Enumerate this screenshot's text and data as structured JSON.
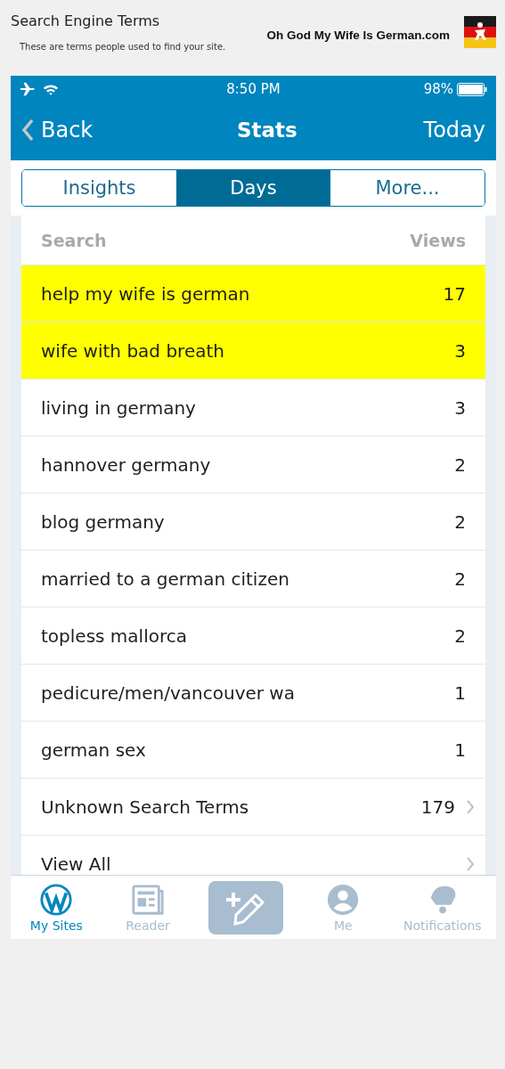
{
  "page": {
    "title": "Search Engine Terms",
    "subtitle": "These are terms people used to find your site.",
    "site_name": "Oh God My Wife Is German.com"
  },
  "status_bar": {
    "time": "8:50 PM",
    "battery": "98%"
  },
  "nav_bar": {
    "back": "Back",
    "title": "Stats",
    "right": "Today"
  },
  "tabs": [
    {
      "label": "Insights",
      "selected": false
    },
    {
      "label": "Days",
      "selected": true
    },
    {
      "label": "More...",
      "selected": false
    }
  ],
  "table": {
    "columns": [
      "Search",
      "Views"
    ],
    "rows": [
      {
        "term": "help my wife is german",
        "views": "17",
        "highlighted": true,
        "kind": "term"
      },
      {
        "term": "wife with bad breath",
        "views": "3",
        "highlighted": true,
        "kind": "term"
      },
      {
        "term": "living in germany",
        "views": "3",
        "highlighted": false,
        "kind": "term"
      },
      {
        "term": "hannover germany",
        "views": "2",
        "highlighted": false,
        "kind": "term"
      },
      {
        "term": "blog germany",
        "views": "2",
        "highlighted": false,
        "kind": "term"
      },
      {
        "term": "married to a german citizen",
        "views": "2",
        "highlighted": false,
        "kind": "term"
      },
      {
        "term": "topless mallorca",
        "views": "2",
        "highlighted": false,
        "kind": "term"
      },
      {
        "term": "pedicure/men/vancouver wa",
        "views": "1",
        "highlighted": false,
        "kind": "term"
      },
      {
        "term": "german sex",
        "views": "1",
        "highlighted": false,
        "kind": "term"
      },
      {
        "term": "Unknown Search Terms",
        "views": "179",
        "highlighted": false,
        "kind": "link"
      },
      {
        "term": "View All",
        "highlighted": false,
        "kind": "link"
      }
    ]
  },
  "tab_bar": [
    {
      "kind": "my-sites",
      "label": "My Sites",
      "selected": true
    },
    {
      "kind": "reader",
      "label": "Reader",
      "selected": false
    },
    {
      "kind": "compose"
    },
    {
      "kind": "me",
      "label": "Me",
      "selected": false
    },
    {
      "kind": "notifications",
      "label": "Notifications",
      "selected": false
    }
  ]
}
